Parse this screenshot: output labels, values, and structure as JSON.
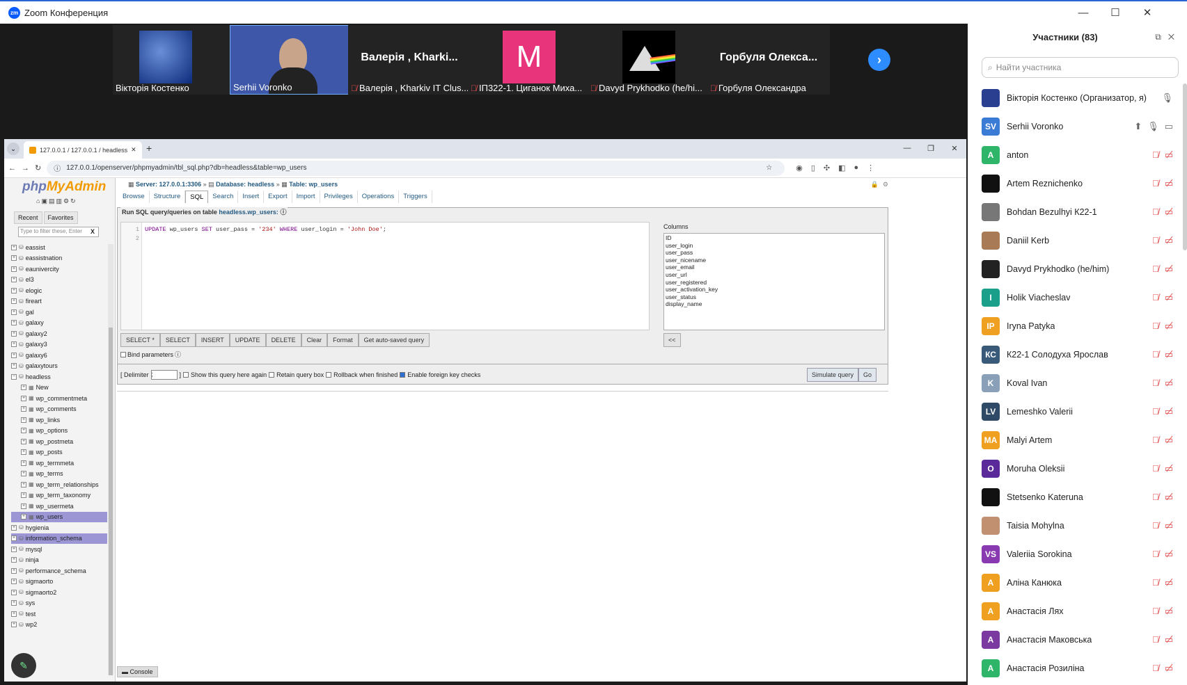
{
  "zoom": {
    "title": "Zoom Конференция",
    "logo": "zm",
    "win_min": "—",
    "win_max": "☐",
    "win_close": "✕"
  },
  "gallery": [
    {
      "name": "Вікторія Костенко",
      "muted": false
    },
    {
      "name": "Serhii Voronko",
      "muted": false
    },
    {
      "name": "Валерія , Kharkiv IT Clus...",
      "big": "Валерія , Kharki...",
      "muted": true
    },
    {
      "name": "ІП322-1. Циганок Миха...",
      "big": "M",
      "muted": true
    },
    {
      "name": "Davyd Prykhodko (he/hi...",
      "muted": true
    },
    {
      "name": "Горбуля Олександра",
      "big": "Горбуля Олекса...",
      "muted": true
    }
  ],
  "browser": {
    "tab_title": "127.0.0.1 / 127.0.0.1 / headless",
    "url": "127.0.0.1/openserver/phpmyadmin/tbl_sql.php?db=headless&table=wp_users"
  },
  "pma": {
    "logo_php": "php",
    "logo_my": "MyAdmin",
    "recent": "Recent",
    "favorites": "Favorites",
    "filter_placeholder": "Type to filter these, Enter",
    "filter_clear": "X",
    "tree": [
      {
        "label": "eassist",
        "level": 0
      },
      {
        "label": "eassistnation",
        "level": 0
      },
      {
        "label": "eaunivercity",
        "level": 0
      },
      {
        "label": "el3",
        "level": 0
      },
      {
        "label": "elogic",
        "level": 0
      },
      {
        "label": "fireart",
        "level": 0
      },
      {
        "label": "gal",
        "level": 0
      },
      {
        "label": "galaxy",
        "level": 0
      },
      {
        "label": "galaxy2",
        "level": 0
      },
      {
        "label": "galaxy3",
        "level": 0
      },
      {
        "label": "galaxy6",
        "level": 0
      },
      {
        "label": "galaxytours",
        "level": 0
      },
      {
        "label": "headless",
        "level": 0,
        "open": true
      },
      {
        "label": "New",
        "level": 1
      },
      {
        "label": "wp_commentmeta",
        "level": 1
      },
      {
        "label": "wp_comments",
        "level": 1
      },
      {
        "label": "wp_links",
        "level": 1
      },
      {
        "label": "wp_options",
        "level": 1
      },
      {
        "label": "wp_postmeta",
        "level": 1
      },
      {
        "label": "wp_posts",
        "level": 1
      },
      {
        "label": "wp_termmeta",
        "level": 1
      },
      {
        "label": "wp_terms",
        "level": 1
      },
      {
        "label": "wp_term_relationships",
        "level": 1
      },
      {
        "label": "wp_term_taxonomy",
        "level": 1
      },
      {
        "label": "wp_usermeta",
        "level": 1
      },
      {
        "label": "wp_users",
        "level": 1,
        "selected": true
      },
      {
        "label": "hygienia",
        "level": 0
      },
      {
        "label": "information_schema",
        "level": 0,
        "selected": true
      },
      {
        "label": "mysql",
        "level": 0
      },
      {
        "label": "ninja",
        "level": 0
      },
      {
        "label": "performance_schema",
        "level": 0
      },
      {
        "label": "sigmaorto",
        "level": 0
      },
      {
        "label": "sigmaorto2",
        "level": 0
      },
      {
        "label": "sys",
        "level": 0
      },
      {
        "label": "test",
        "level": 0
      },
      {
        "label": "wp2",
        "level": 0
      }
    ],
    "breadcrumb": {
      "server": "Server: 127.0.0.1:3306",
      "database": "Database: headless",
      "table": "Table: wp_users"
    },
    "tabs": [
      "Browse",
      "Structure",
      "SQL",
      "Search",
      "Insert",
      "Export",
      "Import",
      "Privileges",
      "Operations",
      "Triggers"
    ],
    "active_tab": "SQL",
    "run_label": "Run SQL query/queries on table",
    "run_table": "headless.wp_users:",
    "code": {
      "line1_num": "1",
      "line2_num": "2",
      "k1": "UPDATE",
      "t1": " wp_users ",
      "k2": "SET",
      "t2": " user_pass = ",
      "s1": "'234'",
      "k3": " WHERE",
      "t3": " user_login = ",
      "s2": "'John Doe'",
      "t4": ";"
    },
    "columns_label": "Columns",
    "columns": [
      "ID",
      "user_login",
      "user_pass",
      "user_nicename",
      "user_email",
      "user_url",
      "user_registered",
      "user_activation_key",
      "user_status",
      "display_name"
    ],
    "query_buttons": [
      "SELECT *",
      "SELECT",
      "INSERT",
      "UPDATE",
      "DELETE",
      "Clear",
      "Format",
      "Get auto-saved query"
    ],
    "insert_col_btn": "<<",
    "bind_params": "Bind parameters",
    "delimiter_label": "[ Delimiter",
    "delimiter_value": ";",
    "delimiter_close": "]",
    "show_query": "Show this query here again",
    "retain_box": "Retain query box",
    "rollback": "Rollback when finished",
    "foreign_keys": "Enable foreign key checks",
    "simulate": "Simulate query",
    "go": "Go",
    "console": "Console"
  },
  "participants": {
    "title": "Участники (83)",
    "search_placeholder": "Найти участника",
    "list": [
      {
        "name": "Вікторія Костенко (Организатор, я)",
        "initials": "",
        "color": "#2a3f8f",
        "photo": true,
        "status": "mic"
      },
      {
        "name": "Serhii Voronko",
        "initials": "SV",
        "color": "#3a7bd5",
        "status": "sharing"
      },
      {
        "name": "anton",
        "initials": "A",
        "color": "#2fb56a",
        "status": "muted"
      },
      {
        "name": "Artem  Reznichenko",
        "initials": "",
        "color": "#111111",
        "status": "muted"
      },
      {
        "name": "Bohdan Bezulhyi К22-1",
        "initials": "",
        "color": "#777777",
        "photo": true,
        "status": "muted"
      },
      {
        "name": "Daniil Kerb",
        "initials": "",
        "color": "#a87a55",
        "photo": true,
        "status": "muted"
      },
      {
        "name": "Davyd Prykhodko (he/him)",
        "initials": "",
        "color": "#222222",
        "photo": true,
        "status": "muted"
      },
      {
        "name": "Holik Viacheslav",
        "initials": "I",
        "color": "#1aa08a",
        "status": "muted"
      },
      {
        "name": "Iryna Patyka",
        "initials": "IP",
        "color": "#f0a020",
        "status": "muted"
      },
      {
        "name": "К22-1 Солодуха Ярослав",
        "initials": "КС",
        "color": "#3a5a7a",
        "status": "muted"
      },
      {
        "name": "Koval Ivan",
        "initials": "K",
        "color": "#8aa0b8",
        "status": "muted"
      },
      {
        "name": "Lemeshko Valerii",
        "initials": "LV",
        "color": "#2e4a66",
        "status": "muted"
      },
      {
        "name": "Malyi Artem",
        "initials": "MA",
        "color": "#f0a020",
        "status": "muted"
      },
      {
        "name": "Moruha Oleksii",
        "initials": "O",
        "color": "#5a2a9a",
        "status": "muted"
      },
      {
        "name": "Stetsenko Kateruna",
        "initials": "",
        "color": "#111111",
        "status": "muted"
      },
      {
        "name": "Taisia Mohylna",
        "initials": "",
        "color": "#c09070",
        "photo": true,
        "status": "muted"
      },
      {
        "name": "Valeriia Sorokina",
        "initials": "VS",
        "color": "#8a3ab0",
        "status": "muted"
      },
      {
        "name": "Аліна Канюка",
        "initials": "A",
        "color": "#f0a020",
        "status": "muted"
      },
      {
        "name": "Анастасія Лях",
        "initials": "A",
        "color": "#f0a020",
        "status": "muted"
      },
      {
        "name": "Анастасія Маковська",
        "initials": "A",
        "color": "#7a3aa0",
        "status": "muted"
      },
      {
        "name": "Анастасія Розиліна",
        "initials": "A",
        "color": "#2fb56a",
        "status": "muted"
      }
    ]
  }
}
